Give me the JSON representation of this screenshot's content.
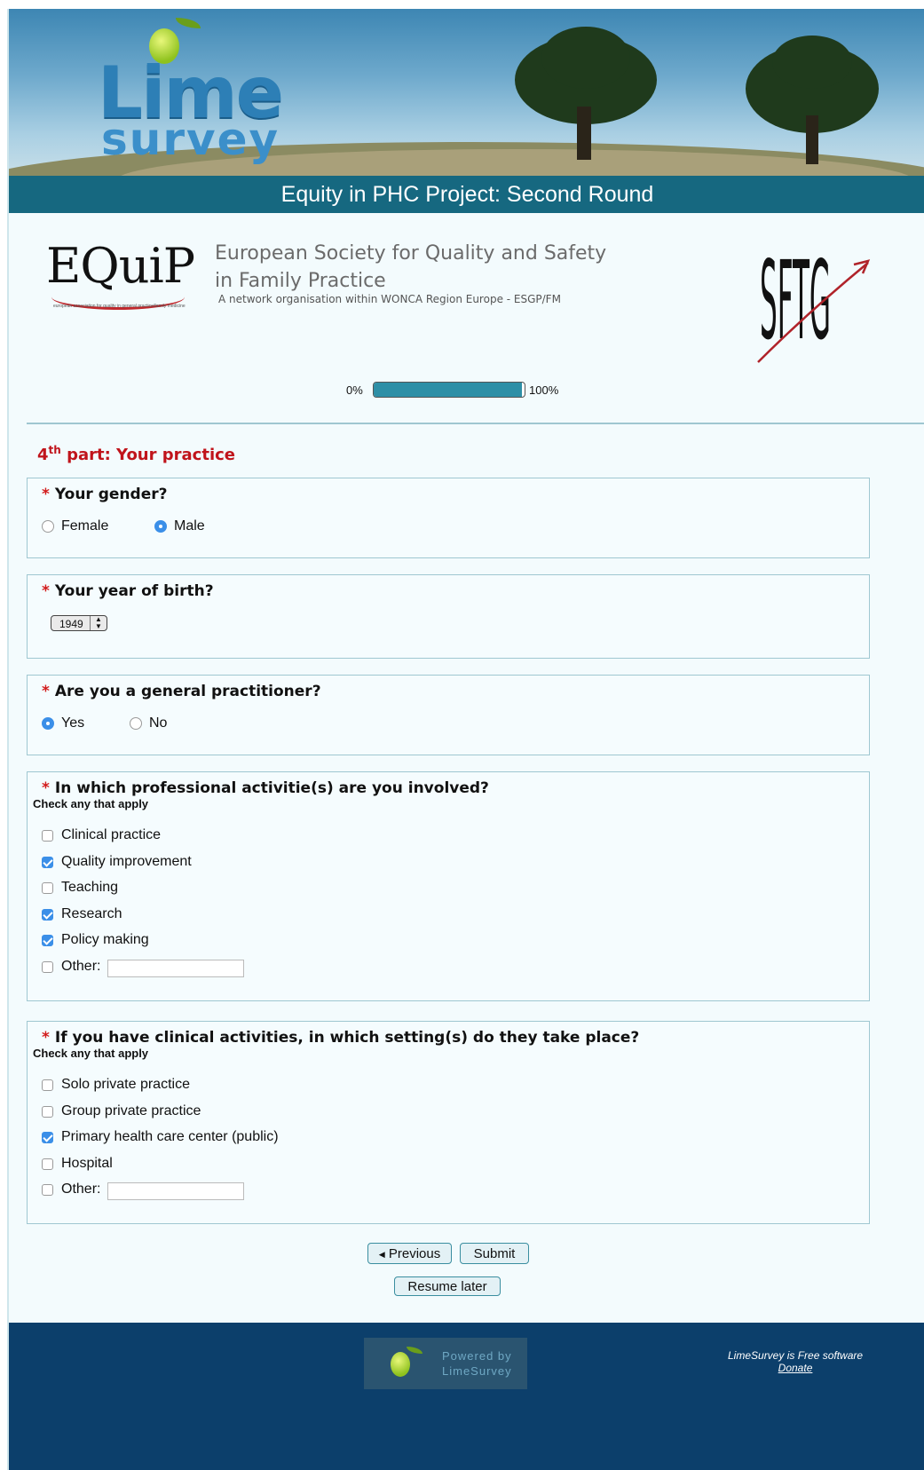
{
  "header": {
    "logo_word": "Lime",
    "logo_subword": "survey",
    "survey_title": "Equity in PHC Project: Second Round"
  },
  "organisations": {
    "equip_logo": "EQuiP",
    "equip_tagline": "european association for quality in general practice/family medicine",
    "esq_title_line1": "European Society for Quality and Safety",
    "esq_title_line2": "in Family Practice",
    "esq_subtitle": "A network organisation within WONCA Region Europe - ESGP/FM",
    "sftg_logo": "SFTG"
  },
  "progress": {
    "start_label": "0%",
    "end_label": "100%",
    "percent_complete": 98
  },
  "section": {
    "ordinal": "4",
    "ordinal_suffix": "th",
    "title": " part: Your practice"
  },
  "questions": {
    "required_mark": "*",
    "gender": {
      "text": "Your gender?",
      "options": [
        {
          "label": "Female",
          "selected": false
        },
        {
          "label": "Male",
          "selected": true
        }
      ]
    },
    "birth_year": {
      "text": "Your year of birth?",
      "selected": "1949"
    },
    "gp": {
      "text": "Are you a general practitioner?",
      "options": [
        {
          "label": "Yes",
          "selected": true
        },
        {
          "label": "No",
          "selected": false
        }
      ]
    },
    "activities": {
      "text": "In which professional activitie(s) are you involved?",
      "help": "Check any that apply",
      "options": [
        {
          "label": "Clinical practice",
          "checked": false
        },
        {
          "label": "Quality improvement",
          "checked": true
        },
        {
          "label": "Teaching",
          "checked": false
        },
        {
          "label": "Research",
          "checked": true
        },
        {
          "label": "Policy making",
          "checked": true
        },
        {
          "label": "Other:",
          "checked": false
        }
      ],
      "other_value": ""
    },
    "settings": {
      "text": "If you have clinical activities, in which setting(s) do they take place?",
      "help": "Check any that apply",
      "options": [
        {
          "label": "Solo private practice",
          "checked": false
        },
        {
          "label": "Group private practice",
          "checked": false
        },
        {
          "label": "Primary health care center (public)",
          "checked": true
        },
        {
          "label": "Hospital",
          "checked": false
        },
        {
          "label": "Other:",
          "checked": false
        }
      ],
      "other_value": ""
    }
  },
  "navigation": {
    "previous_label": "Previous",
    "submit_label": "Submit",
    "resume_label": "Resume later"
  },
  "footer": {
    "powered_line1": "Powered by",
    "powered_line2": "LimeSurvey",
    "free_text": "LimeSurvey is Free software",
    "donate_label": "Donate"
  },
  "colors": {
    "title_bar": "#166880",
    "footer": "#0c3f6b",
    "section_title": "#c0141b",
    "required_star": "#d21b1b",
    "progress_fill": "#2e8fa6",
    "control_selected": "#3b8fe8"
  }
}
